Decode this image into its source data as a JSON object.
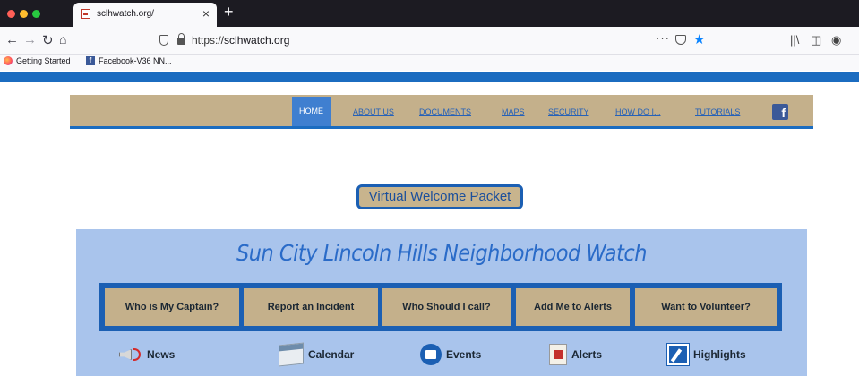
{
  "browser": {
    "tab_title": "sclhwatch.org/",
    "tab_close": "×",
    "new_tab": "+",
    "url_prefix": "https://",
    "url_host": "sclhwatch.org",
    "url_more": "···",
    "bookmarks": [
      {
        "label": "Getting Started",
        "icon": "firefox-icon"
      },
      {
        "label": "Facebook-V36 NN...",
        "icon": "facebook-icon"
      }
    ]
  },
  "site": {
    "colors": {
      "brand_blue": "#1b6cc0",
      "tan": "#c4b08b",
      "panel": "#a9c4ec"
    },
    "menu": [
      "HOME",
      "ABOUT US",
      "DOCUMENTS",
      "MAPS",
      "SECURITY",
      "HOW DO I...",
      "TUTORIALS"
    ],
    "facebook_letter": "f",
    "welcome_packet": "Virtual Welcome Packet",
    "headline": "Sun City Lincoln Hills Neighborhood Watch",
    "quick_buttons": [
      "Who is My Captain?",
      "Report an Incident",
      "Who Should I call?",
      "Add Me to Alerts",
      "Want to Volunteer?"
    ],
    "shortcuts": [
      {
        "label": "News",
        "icon": "megaphone-icon"
      },
      {
        "label": "Calendar",
        "icon": "calendar-icon"
      },
      {
        "label": "Events",
        "icon": "events-icon"
      },
      {
        "label": "Alerts",
        "icon": "alert-icon"
      },
      {
        "label": "Highlights",
        "icon": "highlighter-icon"
      }
    ]
  }
}
